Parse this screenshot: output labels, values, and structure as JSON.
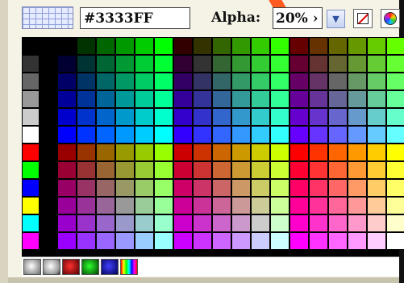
{
  "toolbar": {
    "hex_value": "#3333FF",
    "alpha_label": "Alpha:",
    "alpha_value": "20% ›",
    "dropdown_glyph": "▼"
  },
  "icons": {
    "grid": "grid-icon",
    "no_color": "no-color-icon",
    "system_color": "color-wheel-icon",
    "dropdown": "chevron-down-icon"
  },
  "palette": {
    "left_column": [
      "#000000",
      "#333333",
      "#666666",
      "#999999",
      "#cccccc",
      "#ffffff",
      "#ff0000",
      "#00ff00",
      "#0000ff",
      "#ffff00",
      "#00ffff",
      "#ff00ff"
    ],
    "levels": [
      "00",
      "33",
      "66",
      "99",
      "CC",
      "FF"
    ]
  },
  "gradients": [
    "gray-radial",
    "silver-radial",
    "red-radial",
    "green-radial",
    "blue-radial",
    "rainbow-linear"
  ]
}
